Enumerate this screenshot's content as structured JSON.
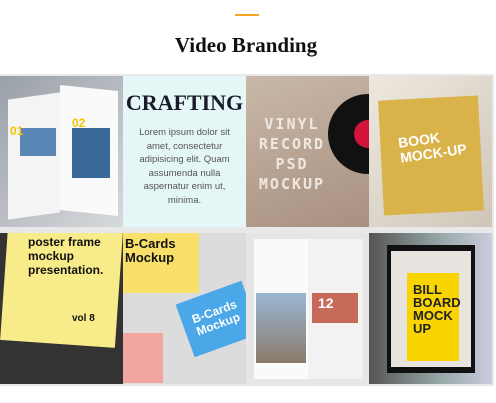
{
  "header": {
    "title": "Video Branding",
    "accent_color": "#f5a623"
  },
  "tiles": {
    "magazine": {
      "numbers": [
        "01",
        "02"
      ]
    },
    "crafting": {
      "title": "CRAFTING",
      "text": "Lorem ipsum dolor sit amet, consectetur adipisicing elit. Quam assumenda nulla aspernatur enim ut, minima."
    },
    "vinyl": {
      "text": "VINYL RECORD PSD MOCKUP"
    },
    "book": {
      "text": "BOOK MOCK-UP"
    },
    "poster": {
      "text": "poster frame mockup presentation.",
      "vol": "vol 8"
    },
    "cards": {
      "text1": "B-Cards Mockup",
      "text2": "B-Cards Mockup"
    },
    "magazine2": {
      "numbers": "12"
    },
    "billboard": {
      "text": "BILL BOARD MOCK UP"
    }
  }
}
